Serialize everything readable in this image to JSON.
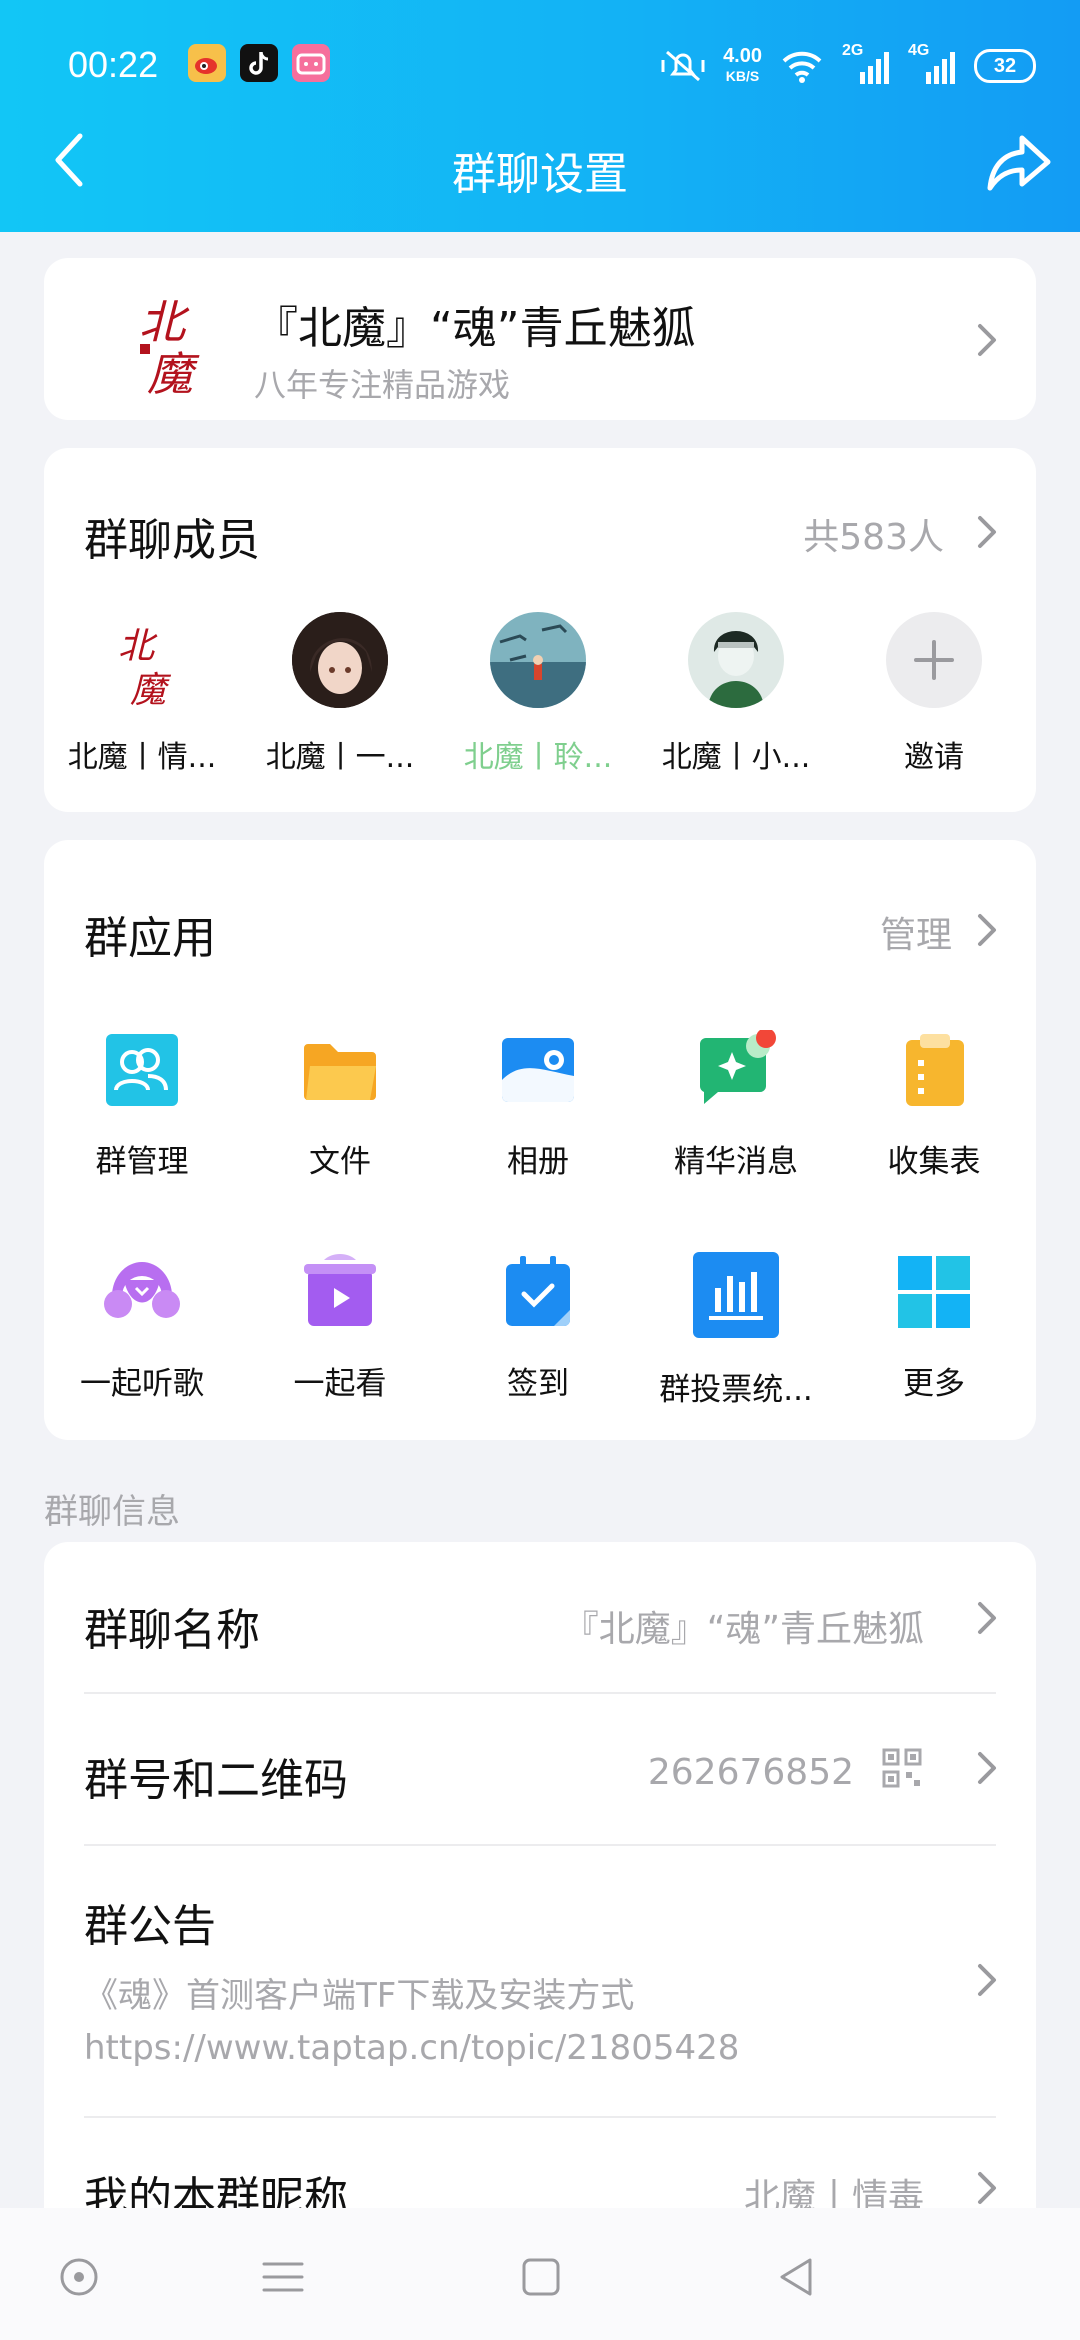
{
  "status_bar": {
    "time": "00:22",
    "apps": [
      "weibo-icon",
      "tiktok-icon",
      "bilibili-icon"
    ],
    "speed_value": "4.00",
    "speed_unit": "KB/S",
    "net1": "2G",
    "net2": "4G",
    "battery": "32"
  },
  "nav": {
    "title": "群聊设置",
    "back_icon": "back-arrow-icon",
    "share_icon": "share-icon"
  },
  "group": {
    "logo_text": "北魔",
    "name": "『北魔』“魂”青丘魅狐",
    "desc": "八年专注精品游戏"
  },
  "members": {
    "title": "群聊成员",
    "count": "共583人",
    "list": [
      {
        "name": "北魔丨情..."
      },
      {
        "name": "北魔丨一..."
      },
      {
        "name": "北魔丨聆..."
      },
      {
        "name": "北魔丨小..."
      },
      {
        "name": "邀请"
      }
    ]
  },
  "apps": {
    "title": "群应用",
    "manage": "管理",
    "items": [
      {
        "label": "群管理",
        "icon": "group-manage-icon"
      },
      {
        "label": "文件",
        "icon": "folder-icon"
      },
      {
        "label": "相册",
        "icon": "album-icon"
      },
      {
        "label": "精华消息",
        "icon": "essence-message-icon"
      },
      {
        "label": "收集表",
        "icon": "form-icon"
      },
      {
        "label": "一起听歌",
        "icon": "headphones-icon"
      },
      {
        "label": "一起看",
        "icon": "tv-play-icon"
      },
      {
        "label": "签到",
        "icon": "calendar-check-icon"
      },
      {
        "label": "群投票统...",
        "icon": "chart-icon"
      },
      {
        "label": "更多",
        "icon": "grid-icon"
      }
    ]
  },
  "info": {
    "section_label": "群聊信息",
    "name_label": "群聊名称",
    "name_value": "『北魔』“魂”青丘魅狐",
    "number_label": "群号和二维码",
    "number_value": "262676852",
    "notice_label": "群公告",
    "notice_line1": "《魂》首测客户端TF下载及安装方式",
    "notice_line2": "https://www.taptap.cn/topic/21805428",
    "nickname_label": "我的本群昵称",
    "nickname_value": "北魔丨情毒"
  },
  "colors": {
    "accent": "#13b3f5",
    "muted": "#a8a8ac"
  }
}
